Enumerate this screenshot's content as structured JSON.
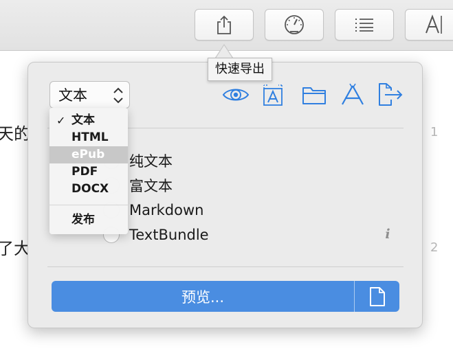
{
  "toolbar": {
    "buttons": [
      {
        "name": "share-export",
        "icon": "share-icon"
      },
      {
        "name": "statistics",
        "icon": "gauge-icon"
      },
      {
        "name": "outline",
        "icon": "list-icon"
      },
      {
        "name": "typography",
        "icon": "text-cursor-icon",
        "label": "A"
      }
    ]
  },
  "document": {
    "fragments": [
      "天的",
      "了大"
    ],
    "line_numbers": [
      "1",
      "2"
    ]
  },
  "tooltip": {
    "text": "快速导出"
  },
  "export_popover": {
    "format_select": {
      "value": "文本"
    },
    "format_menu": {
      "items": [
        "文本",
        "HTML",
        "ePub",
        "PDF",
        "DOCX"
      ],
      "checked": "文本",
      "highlighted": "ePub",
      "publish": "发布"
    },
    "action_icons": [
      "eye-icon",
      "text-box-icon",
      "folder-icon",
      "app-store-icon",
      "export-icon"
    ],
    "text_options": [
      "纯文本",
      "富文本",
      "Markdown",
      "TextBundle"
    ],
    "info_label": "i",
    "preview_button": {
      "label": "预览..."
    }
  },
  "colors": {
    "accent": "#4a8de1",
    "icon_blue": "#2f7fe0",
    "panel_bg": "#ebebeb"
  }
}
